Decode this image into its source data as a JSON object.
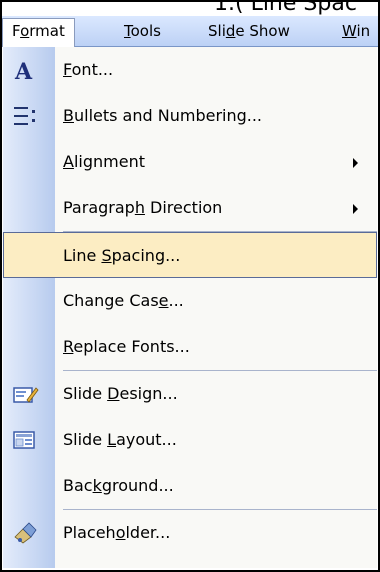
{
  "fragment": {
    "text": "1.( Line Spac"
  },
  "menubar": {
    "items": [
      {
        "before": "F",
        "mnemonic": "o",
        "after": "rmat"
      },
      {
        "before": "",
        "mnemonic": "T",
        "after": "ools"
      },
      {
        "before": "Sli",
        "mnemonic": "d",
        "after": "e Show"
      },
      {
        "before": "",
        "mnemonic": "W",
        "after": "in"
      }
    ]
  },
  "menu": {
    "accent_highlight": "#fcedc3",
    "items": [
      {
        "icon": "font-icon",
        "before": "",
        "mnemonic": "F",
        "after": "ont..."
      },
      {
        "icon": "bullets-icon",
        "before": "",
        "mnemonic": "B",
        "after": "ullets and Numbering..."
      },
      {
        "icon": "",
        "before": "",
        "mnemonic": "A",
        "after": "lignment"
      },
      {
        "icon": "",
        "before": "Paragrap",
        "mnemonic": "h",
        "after": " Direction"
      },
      {
        "icon": "",
        "before": "Line ",
        "mnemonic": "S",
        "after": "pacing..."
      },
      {
        "icon": "",
        "before": "Change Cas",
        "mnemonic": "e",
        "after": "..."
      },
      {
        "icon": "",
        "before": "",
        "mnemonic": "R",
        "after": "eplace Fonts..."
      },
      {
        "icon": "slide-design-icon",
        "before": "Slide ",
        "mnemonic": "D",
        "after": "esign..."
      },
      {
        "icon": "slide-layout-icon",
        "before": "Slide ",
        "mnemonic": "L",
        "after": "ayout..."
      },
      {
        "icon": "",
        "before": "Bac",
        "mnemonic": "k",
        "after": "ground..."
      },
      {
        "icon": "placeholder-icon",
        "before": "Placeh",
        "mnemonic": "o",
        "after": "lder..."
      }
    ]
  }
}
